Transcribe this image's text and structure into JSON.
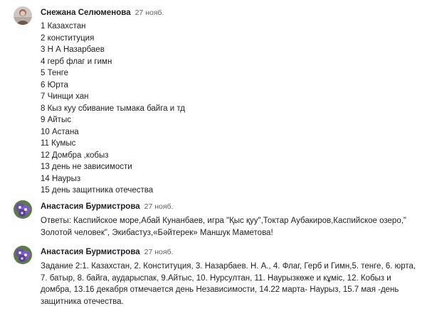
{
  "comments": [
    {
      "author": "Снежана Селюменова",
      "date": "27 нояб.",
      "avatar_icon": "user-photo-icon",
      "lines": [
        "1 Казахстан",
        "2 конституция",
        "3 Н А Назарбаев",
        "4 герб флаг и гимн",
        "5 Тенге",
        "6 Юрта",
        "7 Чинщи хан",
        "8 Кыз куу сбивание тымака байга и тд",
        "9 Айтыс",
        "10 Астана",
        "11 Кумыс",
        "12 Домбра ,кобыз",
        "13 день не зависимости",
        "14 Наурыз",
        "15 день защитника отечества"
      ]
    },
    {
      "author": "Анастасия Бурмистрова",
      "date": "27 нояб.",
      "avatar_icon": "violet-flowers-avatar-icon",
      "lines": [
        "Ответы: Каспийское море,Абай Кунанбаев, игра \"Қыс қуу\",Токтар Аубакиров,Каспийское озеро,\"",
        "Золотой человек\", Экибастуз,«Бәйтерек» Маншук Маметова!"
      ]
    },
    {
      "author": "Анастасия Бурмистрова",
      "date": "27 нояб.",
      "avatar_icon": "violet-flowers-avatar-icon",
      "lines": [
        "Задание 2:1. Казахстан, 2. Конституция, 3. Назарбаев. Н. А., 4. Флаг, Герб и Гимн,5. тенге, 6. юрта,",
        "7. батыр, 8. байга, аударыспак, 9.Айтыс, 10. Нурсултан, 11. Наурызкөже и кұміс, 12. Кобыз и",
        "домбра, 13.16 декабря отмечается день Независимости, 14.22 марта- Наурыз, 15.7 мая -день",
        "защитника отечества."
      ]
    }
  ]
}
